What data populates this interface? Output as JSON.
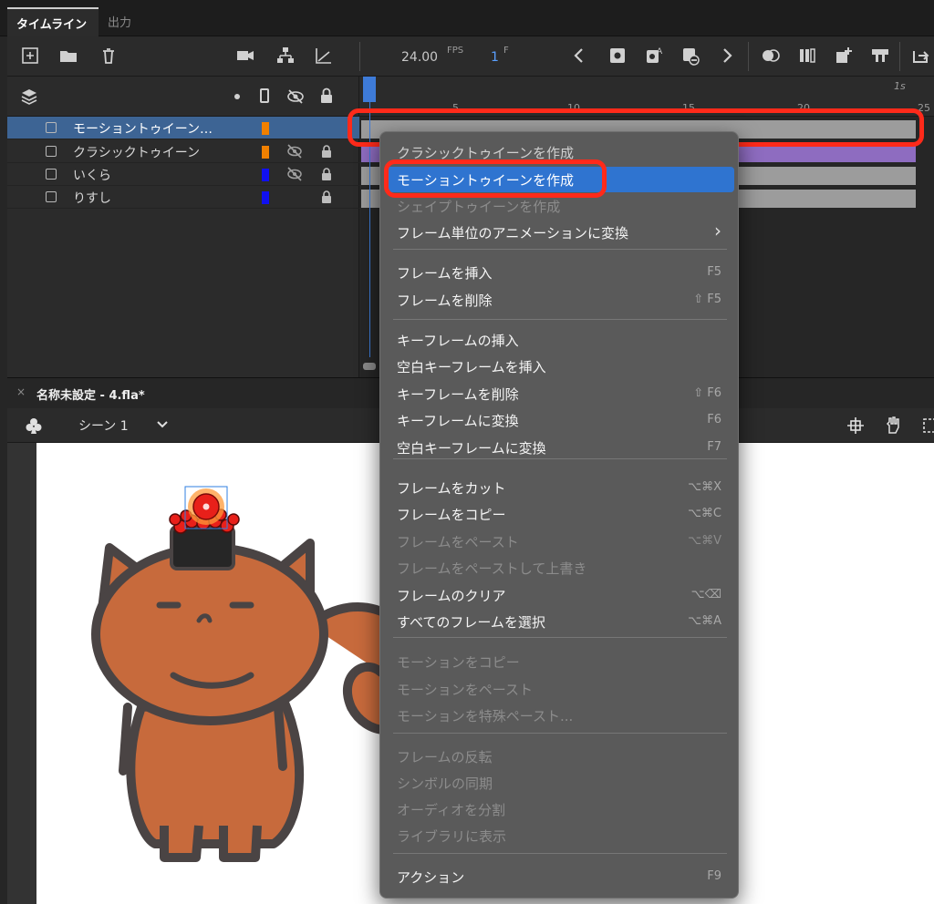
{
  "tabs": {
    "timeline": "タイムライン",
    "output": "出力"
  },
  "toolbar": {
    "fps_value": "24.00",
    "fps_unit": "FPS",
    "frame_value": "1",
    "frame_unit": "F"
  },
  "layers": [
    {
      "name": "モーショントゥイーン…",
      "color": "#f08000",
      "selected": true,
      "hidden": false,
      "locked": false
    },
    {
      "name": "クラシックトゥイーン",
      "color": "#f08000",
      "selected": false,
      "hidden": true,
      "locked": true
    },
    {
      "name": "いくら",
      "color": "#1010f0",
      "selected": false,
      "hidden": true,
      "locked": true
    },
    {
      "name": "りすし",
      "color": "#1010f0",
      "selected": false,
      "hidden": false,
      "locked": true
    }
  ],
  "ruler": {
    "ticks": [
      "5",
      "10",
      "15",
      "20",
      "25"
    ],
    "seconds_label": "1s"
  },
  "document": {
    "close": "×",
    "name": "名称未設定 - 4.fla*",
    "scene": "シーン 1"
  },
  "menu": {
    "partial_top": "クラシックトゥイーンを作成",
    "items": [
      {
        "label": "モーショントゥイーンを作成",
        "shortcut": "",
        "state": "active"
      },
      {
        "label": "シェイプトゥイーンを作成",
        "shortcut": "",
        "state": "disabled"
      },
      {
        "label": "フレーム単位のアニメーションに変換",
        "shortcut": "›",
        "state": "enabled"
      },
      {
        "label": "フレームを挿入",
        "shortcut": "F5",
        "state": "enabled"
      },
      {
        "label": "フレームを削除",
        "shortcut": "⇧ F5",
        "state": "enabled"
      },
      {
        "label": "キーフレームの挿入",
        "shortcut": "",
        "state": "enabled"
      },
      {
        "label": "空白キーフレームを挿入",
        "shortcut": "",
        "state": "enabled"
      },
      {
        "label": "キーフレームを削除",
        "shortcut": "⇧ F6",
        "state": "enabled"
      },
      {
        "label": "キーフレームに変換",
        "shortcut": "F6",
        "state": "enabled"
      },
      {
        "label": "空白キーフレームに変換",
        "shortcut": "F7",
        "state": "enabled"
      },
      {
        "label": "フレームをカット",
        "shortcut": "⌥⌘X",
        "state": "enabled"
      },
      {
        "label": "フレームをコピー",
        "shortcut": "⌥⌘C",
        "state": "enabled"
      },
      {
        "label": "フレームをペースト",
        "shortcut": "⌥⌘V",
        "state": "disabled"
      },
      {
        "label": "フレームをペーストして上書き",
        "shortcut": "",
        "state": "disabled"
      },
      {
        "label": "フレームのクリア",
        "shortcut": "⌥⌫",
        "state": "enabled"
      },
      {
        "label": "すべてのフレームを選択",
        "shortcut": "⌥⌘A",
        "state": "enabled"
      },
      {
        "label": "モーションをコピー",
        "shortcut": "",
        "state": "disabled"
      },
      {
        "label": "モーションをペースト",
        "shortcut": "",
        "state": "disabled"
      },
      {
        "label": "モーションを特殊ペースト...",
        "shortcut": "",
        "state": "disabled"
      },
      {
        "label": "フレームの反転",
        "shortcut": "",
        "state": "disabled"
      },
      {
        "label": "シンボルの同期",
        "shortcut": "",
        "state": "disabled"
      },
      {
        "label": "オーディオを分割",
        "shortcut": "",
        "state": "disabled"
      },
      {
        "label": "ライブラリに表示",
        "shortcut": "",
        "state": "disabled"
      },
      {
        "label": "アクション",
        "shortcut": "F9",
        "state": "enabled"
      }
    ]
  },
  "colors": {
    "highlight": "#ff2a1a",
    "menu_active": "#2f74d0",
    "selected_layer": "#3d6494",
    "playhead": "#3e7bd8"
  }
}
